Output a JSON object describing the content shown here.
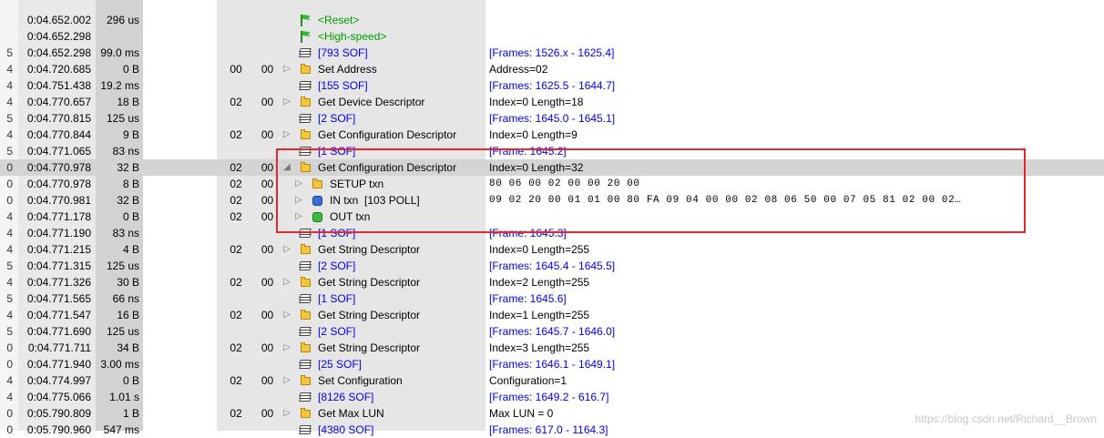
{
  "rows": [
    {
      "idx": "",
      "time": "",
      "dur": "",
      "dev": "",
      "ep": "",
      "exp": "",
      "icon": "",
      "rec": "",
      "rec_color": "black",
      "sum": "",
      "sum_mono": false
    },
    {
      "idx": "",
      "time": "0:04.652.002",
      "dur": "296 us",
      "dev": "",
      "ep": "",
      "exp": "",
      "icon": "flag",
      "rec": "<Reset>",
      "rec_color": "green",
      "sum": "",
      "sum_mono": false
    },
    {
      "idx": "",
      "time": "0:04.652.298",
      "dur": "",
      "dev": "",
      "ep": "",
      "exp": "",
      "icon": "flag",
      "rec": "<High-speed>",
      "rec_color": "green",
      "sum": "",
      "sum_mono": false
    },
    {
      "idx": "5",
      "time": "0:04.652.298",
      "dur": "99.0 ms",
      "dev": "",
      "ep": "",
      "exp": "",
      "icon": "stack",
      "rec": "[793 SOF]",
      "rec_color": "blue",
      "sum": "[Frames: 1526.x - 1625.4]",
      "sum_mono": false
    },
    {
      "idx": "4",
      "time": "0:04.720.685",
      "dur": "0 B",
      "dev": "00",
      "ep": "00",
      "exp": "▷",
      "icon": "folder",
      "rec": "Set Address",
      "rec_color": "black",
      "sum": "Address=02",
      "sum_mono": false
    },
    {
      "idx": "4",
      "time": "0:04.751.438",
      "dur": "19.2 ms",
      "dev": "",
      "ep": "",
      "exp": "",
      "icon": "stack",
      "rec": "[155 SOF]",
      "rec_color": "blue",
      "sum": "[Frames: 1625.5 - 1644.7]",
      "sum_mono": false
    },
    {
      "idx": "4",
      "time": "0:04.770.657",
      "dur": "18 B",
      "dev": "02",
      "ep": "00",
      "exp": "▷",
      "icon": "folder",
      "rec": "Get Device Descriptor",
      "rec_color": "black",
      "sum": "Index=0 Length=18",
      "sum_mono": false
    },
    {
      "idx": "5",
      "time": "0:04.770.815",
      "dur": "125 us",
      "dev": "",
      "ep": "",
      "exp": "",
      "icon": "stack",
      "rec": "[2 SOF]",
      "rec_color": "blue",
      "sum": "[Frames: 1645.0 - 1645.1]",
      "sum_mono": false
    },
    {
      "idx": "4",
      "time": "0:04.770.844",
      "dur": "9 B",
      "dev": "02",
      "ep": "00",
      "exp": "▷",
      "icon": "folder",
      "rec": "Get Configuration Descriptor",
      "rec_color": "black",
      "sum": "Index=0 Length=9",
      "sum_mono": false
    },
    {
      "idx": "5",
      "time": "0:04.771.065",
      "dur": "83 ns",
      "dev": "",
      "ep": "",
      "exp": "",
      "icon": "stack",
      "rec": "[1 SOF]",
      "rec_color": "blue",
      "sum": "[Frame: 1645.2]",
      "sum_mono": false
    },
    {
      "idx": "0",
      "time": "0:04.770.978",
      "dur": "32 B",
      "dev": "02",
      "ep": "00",
      "exp": "◢",
      "icon": "folder",
      "rec": "Get Configuration Descriptor",
      "rec_color": "black",
      "sum": "Index=0 Length=32",
      "sum_mono": false,
      "highlight": true
    },
    {
      "idx": "0",
      "time": "0:04.770.978",
      "dur": "8 B",
      "dev": "02",
      "ep": "00",
      "exp": "▷",
      "icon": "folder",
      "rec": "SETUP txn",
      "rec_color": "black",
      "sum": "80 06 00 02 00 00 20 00",
      "sum_mono": true,
      "indent": true
    },
    {
      "idx": "0",
      "time": "0:04.770.981",
      "dur": "32 B",
      "dev": "02",
      "ep": "00",
      "exp": "▷",
      "icon": "blue",
      "rec": "IN txn  [103 POLL]",
      "rec_color": "black",
      "sum": "09 02 20 00 01 01 00 80 FA 09 04 00 00 02 08 06 50 00 07 05 81 02 00 02…",
      "sum_mono": true,
      "indent": true
    },
    {
      "idx": "4",
      "time": "0:04.771.178",
      "dur": "0 B",
      "dev": "02",
      "ep": "00",
      "exp": "▷",
      "icon": "green",
      "rec": "OUT txn",
      "rec_color": "black",
      "sum": "",
      "sum_mono": false,
      "indent": true
    },
    {
      "idx": "4",
      "time": "0:04.771.190",
      "dur": "83 ns",
      "dev": "",
      "ep": "",
      "exp": "",
      "icon": "stack",
      "rec": "[1 SOF]",
      "rec_color": "blue",
      "sum": "[Frame: 1645.3]",
      "sum_mono": false
    },
    {
      "idx": "4",
      "time": "0:04.771.215",
      "dur": "4 B",
      "dev": "02",
      "ep": "00",
      "exp": "▷",
      "icon": "folder",
      "rec": "Get String Descriptor",
      "rec_color": "black",
      "sum": "Index=0 Length=255",
      "sum_mono": false
    },
    {
      "idx": "5",
      "time": "0:04.771.315",
      "dur": "125 us",
      "dev": "",
      "ep": "",
      "exp": "",
      "icon": "stack",
      "rec": "[2 SOF]",
      "rec_color": "blue",
      "sum": "[Frames: 1645.4 - 1645.5]",
      "sum_mono": false
    },
    {
      "idx": "4",
      "time": "0:04.771.326",
      "dur": "30 B",
      "dev": "02",
      "ep": "00",
      "exp": "▷",
      "icon": "folder",
      "rec": "Get String Descriptor",
      "rec_color": "black",
      "sum": "Index=2 Length=255",
      "sum_mono": false
    },
    {
      "idx": "5",
      "time": "0:04.771.565",
      "dur": "66 ns",
      "dev": "",
      "ep": "",
      "exp": "",
      "icon": "stack",
      "rec": "[1 SOF]",
      "rec_color": "blue",
      "sum": "[Frame: 1645.6]",
      "sum_mono": false
    },
    {
      "idx": "4",
      "time": "0:04.771.547",
      "dur": "16 B",
      "dev": "02",
      "ep": "00",
      "exp": "▷",
      "icon": "folder",
      "rec": "Get String Descriptor",
      "rec_color": "black",
      "sum": "Index=1 Length=255",
      "sum_mono": false
    },
    {
      "idx": "5",
      "time": "0:04.771.690",
      "dur": "125 us",
      "dev": "",
      "ep": "",
      "exp": "",
      "icon": "stack",
      "rec": "[2 SOF]",
      "rec_color": "blue",
      "sum": "[Frames: 1645.7 - 1646.0]",
      "sum_mono": false
    },
    {
      "idx": "0",
      "time": "0:04.771.711",
      "dur": "34 B",
      "dev": "02",
      "ep": "00",
      "exp": "▷",
      "icon": "folder",
      "rec": "Get String Descriptor",
      "rec_color": "black",
      "sum": "Index=3 Length=255",
      "sum_mono": false
    },
    {
      "idx": "0",
      "time": "0:04.771.940",
      "dur": "3.00 ms",
      "dev": "",
      "ep": "",
      "exp": "",
      "icon": "stack",
      "rec": "[25 SOF]",
      "rec_color": "blue",
      "sum": "[Frames: 1646.1 - 1649.1]",
      "sum_mono": false
    },
    {
      "idx": "4",
      "time": "0:04.774.997",
      "dur": "0 B",
      "dev": "02",
      "ep": "00",
      "exp": "▷",
      "icon": "folder",
      "rec": "Set Configuration",
      "rec_color": "black",
      "sum": "Configuration=1",
      "sum_mono": false
    },
    {
      "idx": "4",
      "time": "0:04.775.066",
      "dur": "1.01 s",
      "dev": "",
      "ep": "",
      "exp": "",
      "icon": "stack",
      "rec": "[8126 SOF]",
      "rec_color": "blue",
      "sum": "[Frames: 1649.2 - 616.7]",
      "sum_mono": false
    },
    {
      "idx": "0",
      "time": "0:05.790.809",
      "dur": "1 B",
      "dev": "02",
      "ep": "00",
      "exp": "▷",
      "icon": "folder",
      "rec": "Get Max LUN",
      "rec_color": "black",
      "sum": "Max LUN = 0",
      "sum_mono": false
    },
    {
      "idx": "0",
      "time": "0:05.790.960",
      "dur": "547 ms",
      "dev": "",
      "ep": "",
      "exp": "",
      "icon": "stack",
      "rec": "[4380 SOF]",
      "rec_color": "blue",
      "sum": "[Frames: 617.0 - 1164.3]",
      "sum_mono": false
    }
  ],
  "watermark": "https://blog.csdn.net/Richard__Brown"
}
